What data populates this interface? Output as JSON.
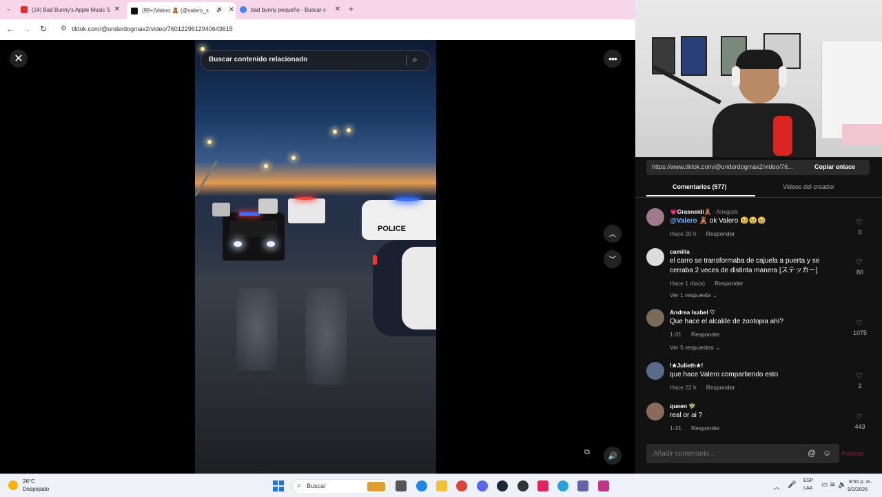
{
  "browser": {
    "tabs": [
      {
        "title": "(24) Bad Bunny's Apple Music S",
        "favicon": "youtube-icon",
        "color": "#e52d27"
      },
      {
        "title": "(99+)Valero 🧸 (@valero_s",
        "favicon": "tiktok-icon",
        "color": "#111111"
      },
      {
        "title": "bad bunny pequeño - Buscar c",
        "favicon": "google-icon",
        "color": "#4285f4"
      }
    ],
    "url": "tiktok.com/@underdogmax2/video/7601229612940643615"
  },
  "player": {
    "search_placeholder": "Buscar contenido relacionado",
    "police_text": "POLICE"
  },
  "panel": {
    "share_link": "https://www.tiktok.com/@underdogmax2/video/76...",
    "copy_label": "Copiar enlace",
    "tab_comments": "Comentarios (577)",
    "tab_videos": "Videos del creador",
    "comments": [
      {
        "name": "💗Grasneidi🧸",
        "tag": "· Amigo/a",
        "mention": "@Valero 🧸",
        "text": " ok Valero 🥹🥹🥹",
        "time": "Hace 20 h",
        "reply": "Responder",
        "likes": "0",
        "avatar_color": "#a07a8a"
      },
      {
        "name": "camilla",
        "tag": "",
        "mention": "",
        "text": "el carro se transformaba de cajuela a puerta y se cerraba 2 veces de distinta manera [ステッカー]",
        "time": "Hace 1 día(s)",
        "reply": "Responder",
        "likes": "80",
        "replies": "Ver 1 respuesta ⌄",
        "avatar_color": "#dcdcdc"
      },
      {
        "name": "Andrea Isabel ♡",
        "tag": "",
        "mention": "",
        "text": "Que hace el alcalde de zootopia ahí?",
        "time": "1-31",
        "reply": "Responder",
        "likes": "1075",
        "replies": "Ver 5 respuestas ⌄",
        "avatar_color": "#7a6a5a"
      },
      {
        "name": "!★Julieth★!",
        "tag": "",
        "mention": "",
        "text": "que hace Valero compartiendo esto",
        "time": "Hace 22 h",
        "reply": "Responder",
        "likes": "2",
        "avatar_color": "#5a6a8a"
      },
      {
        "name": "queen 🧚",
        "tag": "",
        "mention": "",
        "text": "real or ai ?",
        "time": "1-31",
        "reply": "Responder",
        "likes": "443",
        "avatar_color": "#8a6a5a"
      }
    ],
    "composer_placeholder": "Añadir comentario...",
    "publish_label": "Publicar"
  },
  "taskbar": {
    "temp": "26°C",
    "weather": "Despejado",
    "search": "Buscar",
    "lang1": "ESP",
    "lang2": "LAA",
    "time": "8:50 p. m.",
    "date": "9/2/2026"
  }
}
